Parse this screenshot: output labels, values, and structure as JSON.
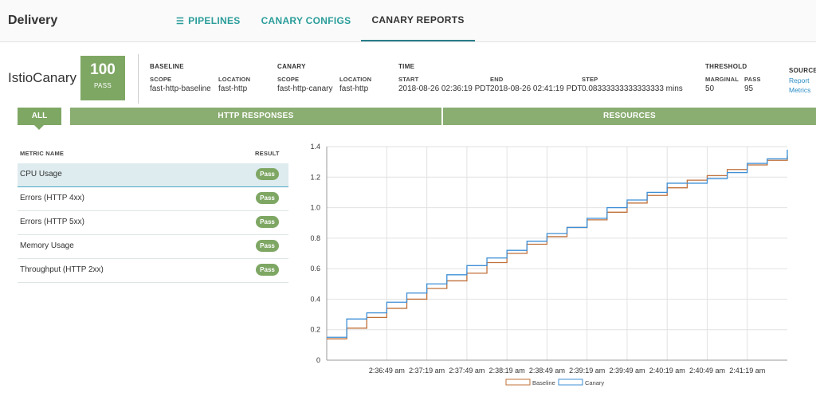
{
  "app": {
    "title": "Delivery"
  },
  "nav": {
    "pipelines": "PIPELINES",
    "canary_configs": "CANARY CONFIGS",
    "canary_reports": "CANARY REPORTS"
  },
  "report": {
    "name": "IstioCanary",
    "score": "100",
    "score_label": "PASS",
    "baseline": {
      "header": "BASELINE",
      "scope_label": "SCOPE",
      "scope": "fast-http-baseline",
      "location_label": "LOCATION",
      "location": "fast-http"
    },
    "canary": {
      "header": "CANARY",
      "scope_label": "SCOPE",
      "scope": "fast-http-canary",
      "location_label": "LOCATION",
      "location": "fast-http"
    },
    "time": {
      "header": "TIME",
      "start_label": "START",
      "start": "2018-08-26 02:36:19 PDT",
      "end_label": "END",
      "end": "2018-08-26 02:41:19 PDT",
      "step_label": "STEP",
      "step": "0.08333333333333333 mins"
    },
    "threshold": {
      "header": "THRESHOLD",
      "marginal_label": "MARGINAL",
      "marginal": "50",
      "pass_label": "PASS",
      "pass": "95"
    },
    "source": {
      "header": "SOURCE",
      "report": "Report",
      "metrics": "Metrics"
    }
  },
  "tabs": {
    "all": "ALL",
    "http": "HTTP RESPONSES",
    "resources": "RESOURCES"
  },
  "metrics_table": {
    "col_name": "METRIC NAME",
    "col_result": "RESULT",
    "rows": [
      {
        "name": "CPU Usage",
        "result": "Pass"
      },
      {
        "name": "Errors (HTTP 4xx)",
        "result": "Pass"
      },
      {
        "name": "Errors (HTTP 5xx)",
        "result": "Pass"
      },
      {
        "name": "Memory Usage",
        "result": "Pass"
      },
      {
        "name": "Throughput (HTTP 2xx)",
        "result": "Pass"
      }
    ]
  },
  "chart_data": {
    "type": "line",
    "step": true,
    "x_ticks": [
      "2:36:49 am",
      "2:37:19 am",
      "2:37:49 am",
      "2:38:19 am",
      "2:38:49 am",
      "2:39:19 am",
      "2:39:49 am",
      "2:40:19 am",
      "2:40:49 am",
      "2:41:19 am"
    ],
    "x_range_seconds": [
      -45,
      300
    ],
    "y_ticks": [
      0,
      0.2,
      0.4,
      0.6,
      0.8,
      1.0,
      1.2,
      1.4
    ],
    "ylim": [
      0,
      1.4
    ],
    "grid": true,
    "legend_position": "bottom",
    "series": [
      {
        "name": "Baseline",
        "color": "#c0703a",
        "x": [
          -45,
          -30,
          -15,
          0,
          15,
          30,
          45,
          60,
          75,
          90,
          105,
          120,
          135,
          150,
          165,
          180,
          195,
          210,
          225,
          240,
          255,
          270,
          285,
          300
        ],
        "values": [
          0.14,
          0.21,
          0.28,
          0.34,
          0.4,
          0.47,
          0.52,
          0.57,
          0.64,
          0.7,
          0.76,
          0.81,
          0.87,
          0.92,
          0.97,
          1.03,
          1.08,
          1.13,
          1.18,
          1.21,
          1.25,
          1.28,
          1.31,
          1.34
        ]
      },
      {
        "name": "Canary",
        "color": "#3d8fd6",
        "x": [
          -45,
          -30,
          -15,
          0,
          15,
          30,
          45,
          60,
          75,
          90,
          105,
          120,
          135,
          150,
          165,
          180,
          195,
          210,
          225,
          240,
          255,
          270,
          285,
          300
        ],
        "values": [
          0.15,
          0.27,
          0.31,
          0.38,
          0.44,
          0.5,
          0.56,
          0.62,
          0.67,
          0.72,
          0.78,
          0.83,
          0.87,
          0.93,
          1.0,
          1.05,
          1.1,
          1.16,
          1.16,
          1.19,
          1.23,
          1.29,
          1.32,
          1.38
        ]
      }
    ]
  }
}
